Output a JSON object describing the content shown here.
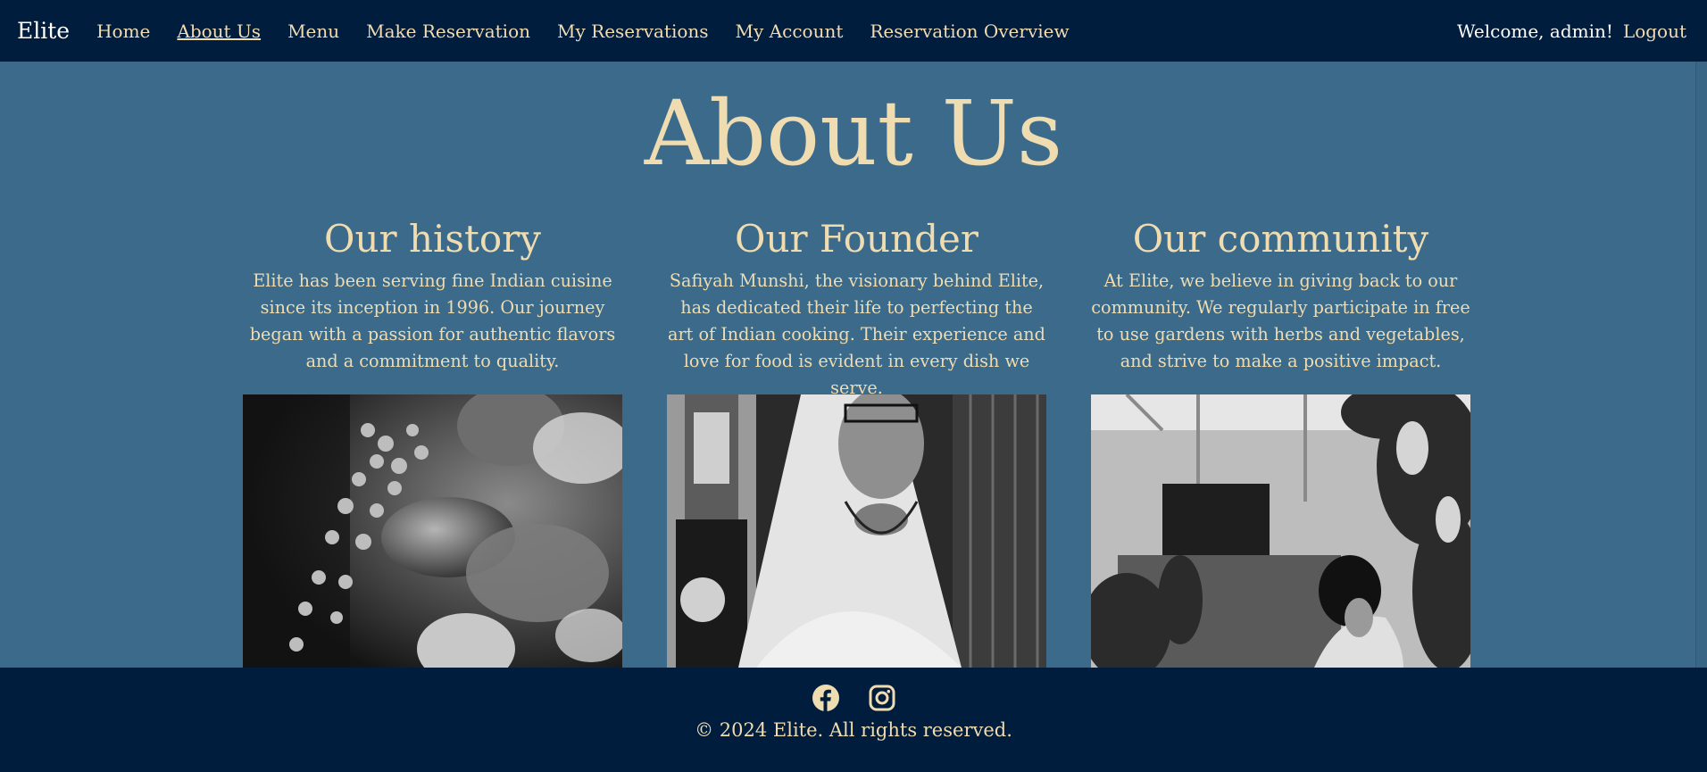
{
  "brand": "Elite",
  "nav": {
    "items": [
      {
        "label": "Home"
      },
      {
        "label": "About Us"
      },
      {
        "label": "Menu"
      },
      {
        "label": "Make Reservation"
      },
      {
        "label": "My Reservations"
      },
      {
        "label": "My Account"
      },
      {
        "label": "Reservation Overview"
      }
    ],
    "active": "About Us"
  },
  "user": {
    "welcome": "Welcome, admin!",
    "logout": "Logout"
  },
  "page": {
    "title": "About Us"
  },
  "sections": [
    {
      "heading": "Our history",
      "text": "Elite has been serving fine Indian cuisine since its inception in 1996. Our journey began with a passion for authentic flavors and a commitment to quality."
    },
    {
      "heading": "Our Founder",
      "text": "Safiyah Munshi, the visionary behind Elite, has dedicated their life to perfecting the art of Indian cooking. Their experience and love for food is evident in every dish we serve."
    },
    {
      "heading": "Our community",
      "text": "At Elite, we believe in giving back to our community. We regularly participate in free to use gardens with herbs and vegetables, and strive to make a positive impact."
    }
  ],
  "footer": {
    "icons": [
      "facebook-icon",
      "instagram-icon"
    ],
    "copyright": "© 2024 Elite. All rights reserved."
  },
  "colors": {
    "navbar": "#001d3d",
    "background": "#3b6a8a",
    "accent": "#efdcb1"
  }
}
